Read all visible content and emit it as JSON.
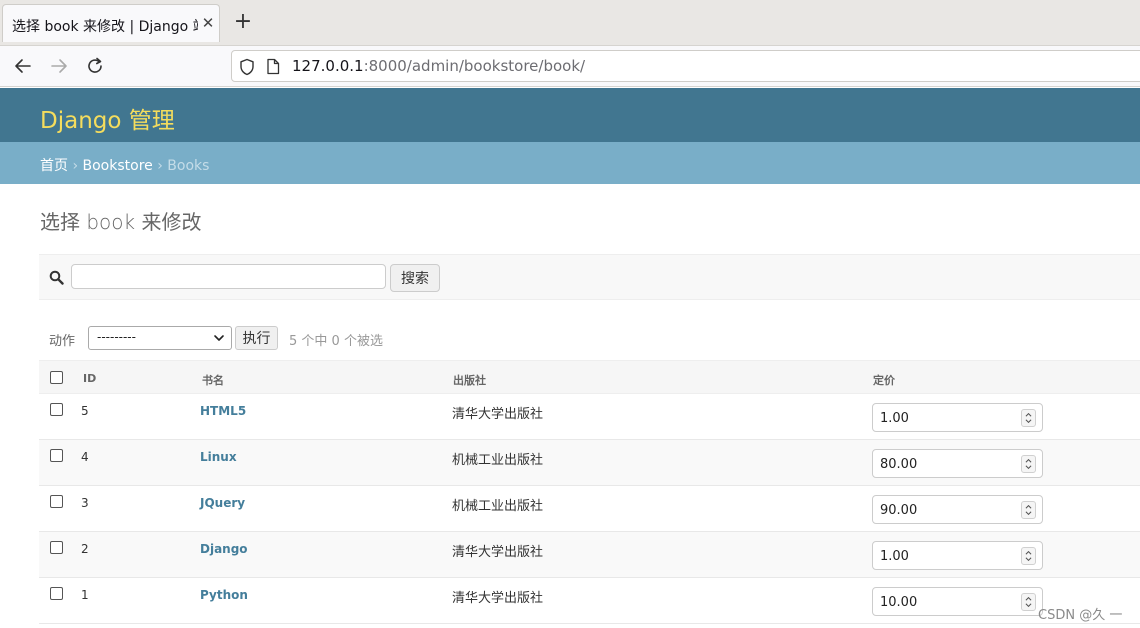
{
  "browser": {
    "tab_title": "选择 book 来修改 | Django 站",
    "url_host": "127.0.0.1",
    "url_path": ":8000/admin/bookstore/book/"
  },
  "header": {
    "site_name": "Django 管理"
  },
  "breadcrumbs": {
    "home": "首页",
    "app": "Bookstore",
    "current": "Books",
    "separator": "›"
  },
  "page": {
    "title": "选择 book 来修改"
  },
  "search": {
    "value": "",
    "button_label": "搜索"
  },
  "actions": {
    "label": "动作",
    "selected_option": "---------",
    "go_label": "执行",
    "counter": "5 个中 0 个被选"
  },
  "table": {
    "columns": [
      "ID",
      "书名",
      "出版社",
      "定价"
    ],
    "rows": [
      {
        "id": "5",
        "title": "HTML5",
        "publisher": "清华大学出版社",
        "price": "1.00"
      },
      {
        "id": "4",
        "title": "Linux",
        "publisher": "机械工业出版社",
        "price": "80.00"
      },
      {
        "id": "3",
        "title": "JQuery",
        "publisher": "机械工业出版社",
        "price": "90.00"
      },
      {
        "id": "2",
        "title": "Django",
        "publisher": "清华大学出版社",
        "price": "1.00"
      },
      {
        "id": "1",
        "title": "Python",
        "publisher": "清华大学出版社",
        "price": "10.00"
      }
    ]
  },
  "watermark": "CSDN @久  一",
  "colors": {
    "header_bg": "#417690",
    "breadcrumb_bg": "#79aec8",
    "site_name": "#f5dd5d",
    "link": "#447e9b"
  },
  "icons": {
    "back": "arrow-left-icon",
    "forward": "arrow-right-icon",
    "reload": "reload-icon",
    "shield": "shield-icon",
    "page": "page-icon",
    "search": "magnifier-icon"
  }
}
